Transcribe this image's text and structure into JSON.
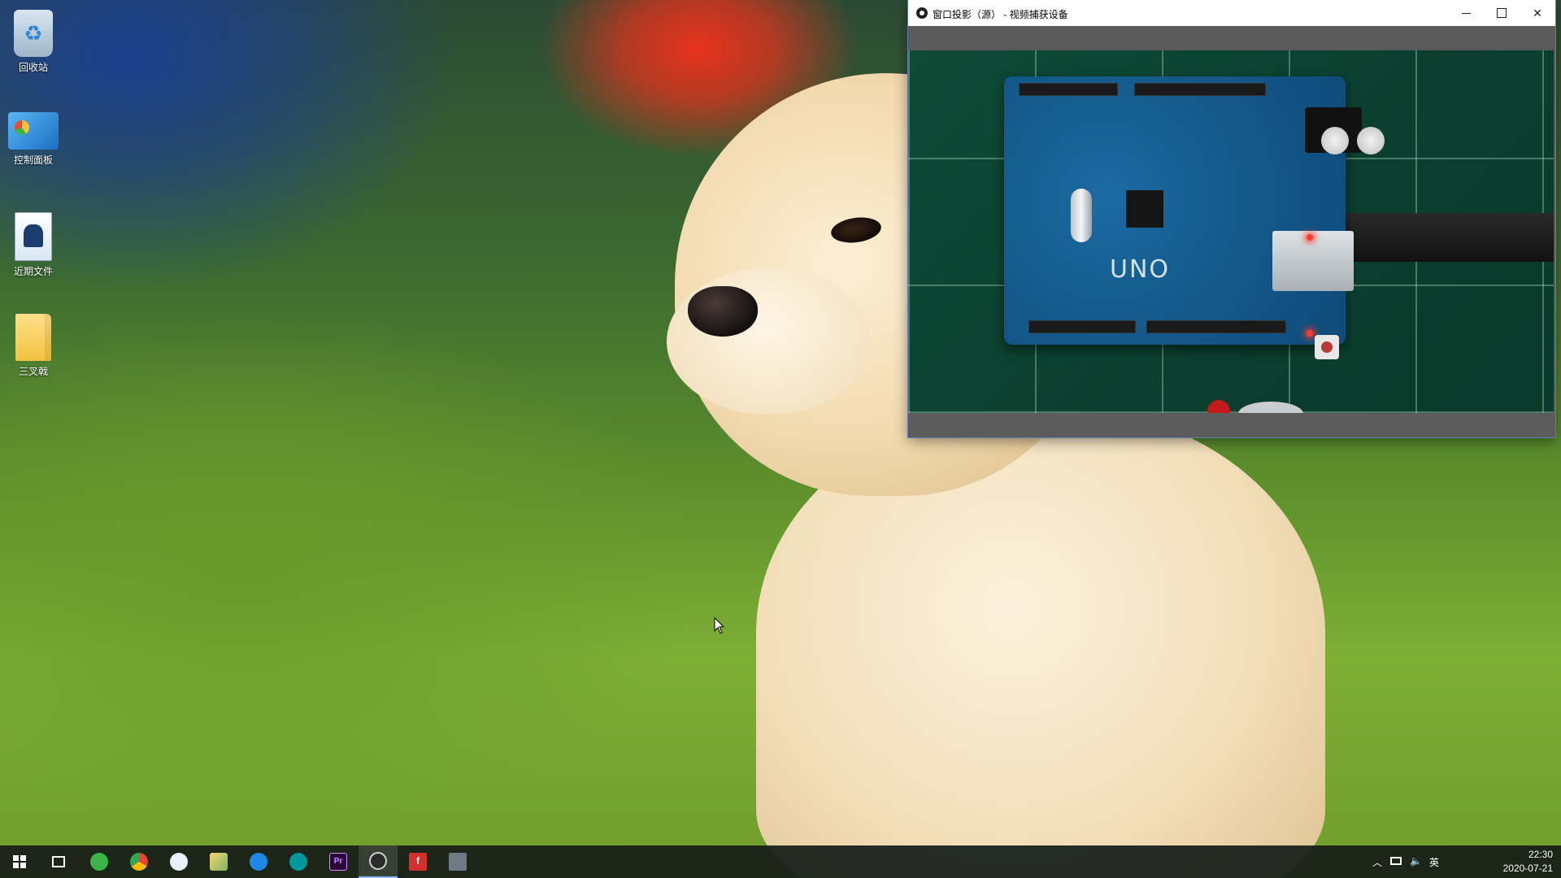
{
  "desktop": {
    "icons": [
      {
        "label": "回收站",
        "icon": "recycle-bin-icon"
      },
      {
        "label": "控制面板",
        "icon": "control-panel-icon"
      },
      {
        "label": "近期文件",
        "icon": "recent-files-icon"
      },
      {
        "label": "三叉戟",
        "icon": "folder-icon"
      }
    ],
    "wallpaper_subject": "puppy-on-grass"
  },
  "window": {
    "title": "窗口投影（源） - 视频捕获设备",
    "buttons": {
      "minimize": "minimize-icon",
      "maximize": "maximize-icon",
      "close": "close-icon"
    },
    "video": {
      "board_label": "UNO",
      "feed_colors": {
        "mat": "#0e4a37",
        "board": "#1b6aa2"
      }
    }
  },
  "taskbar": {
    "apps": [
      {
        "name": "start-icon"
      },
      {
        "name": "task-view-icon"
      },
      {
        "name": "app-green-icon"
      },
      {
        "name": "chrome-icon"
      },
      {
        "name": "media-player-icon"
      },
      {
        "name": "image-viewer-icon"
      },
      {
        "name": "browser-icon"
      },
      {
        "name": "arduino-icon"
      },
      {
        "name": "premiere-icon",
        "letter": "Pr"
      },
      {
        "name": "obs-icon",
        "active": true
      },
      {
        "name": "flash-icon",
        "letter": "f"
      },
      {
        "name": "monitor-icon"
      }
    ],
    "tray": {
      "ime": "英",
      "time": "22:30",
      "date": "2020-07-21"
    },
    "colors": {
      "background": "#141c18",
      "active_underline": "#8ab4f8"
    }
  }
}
